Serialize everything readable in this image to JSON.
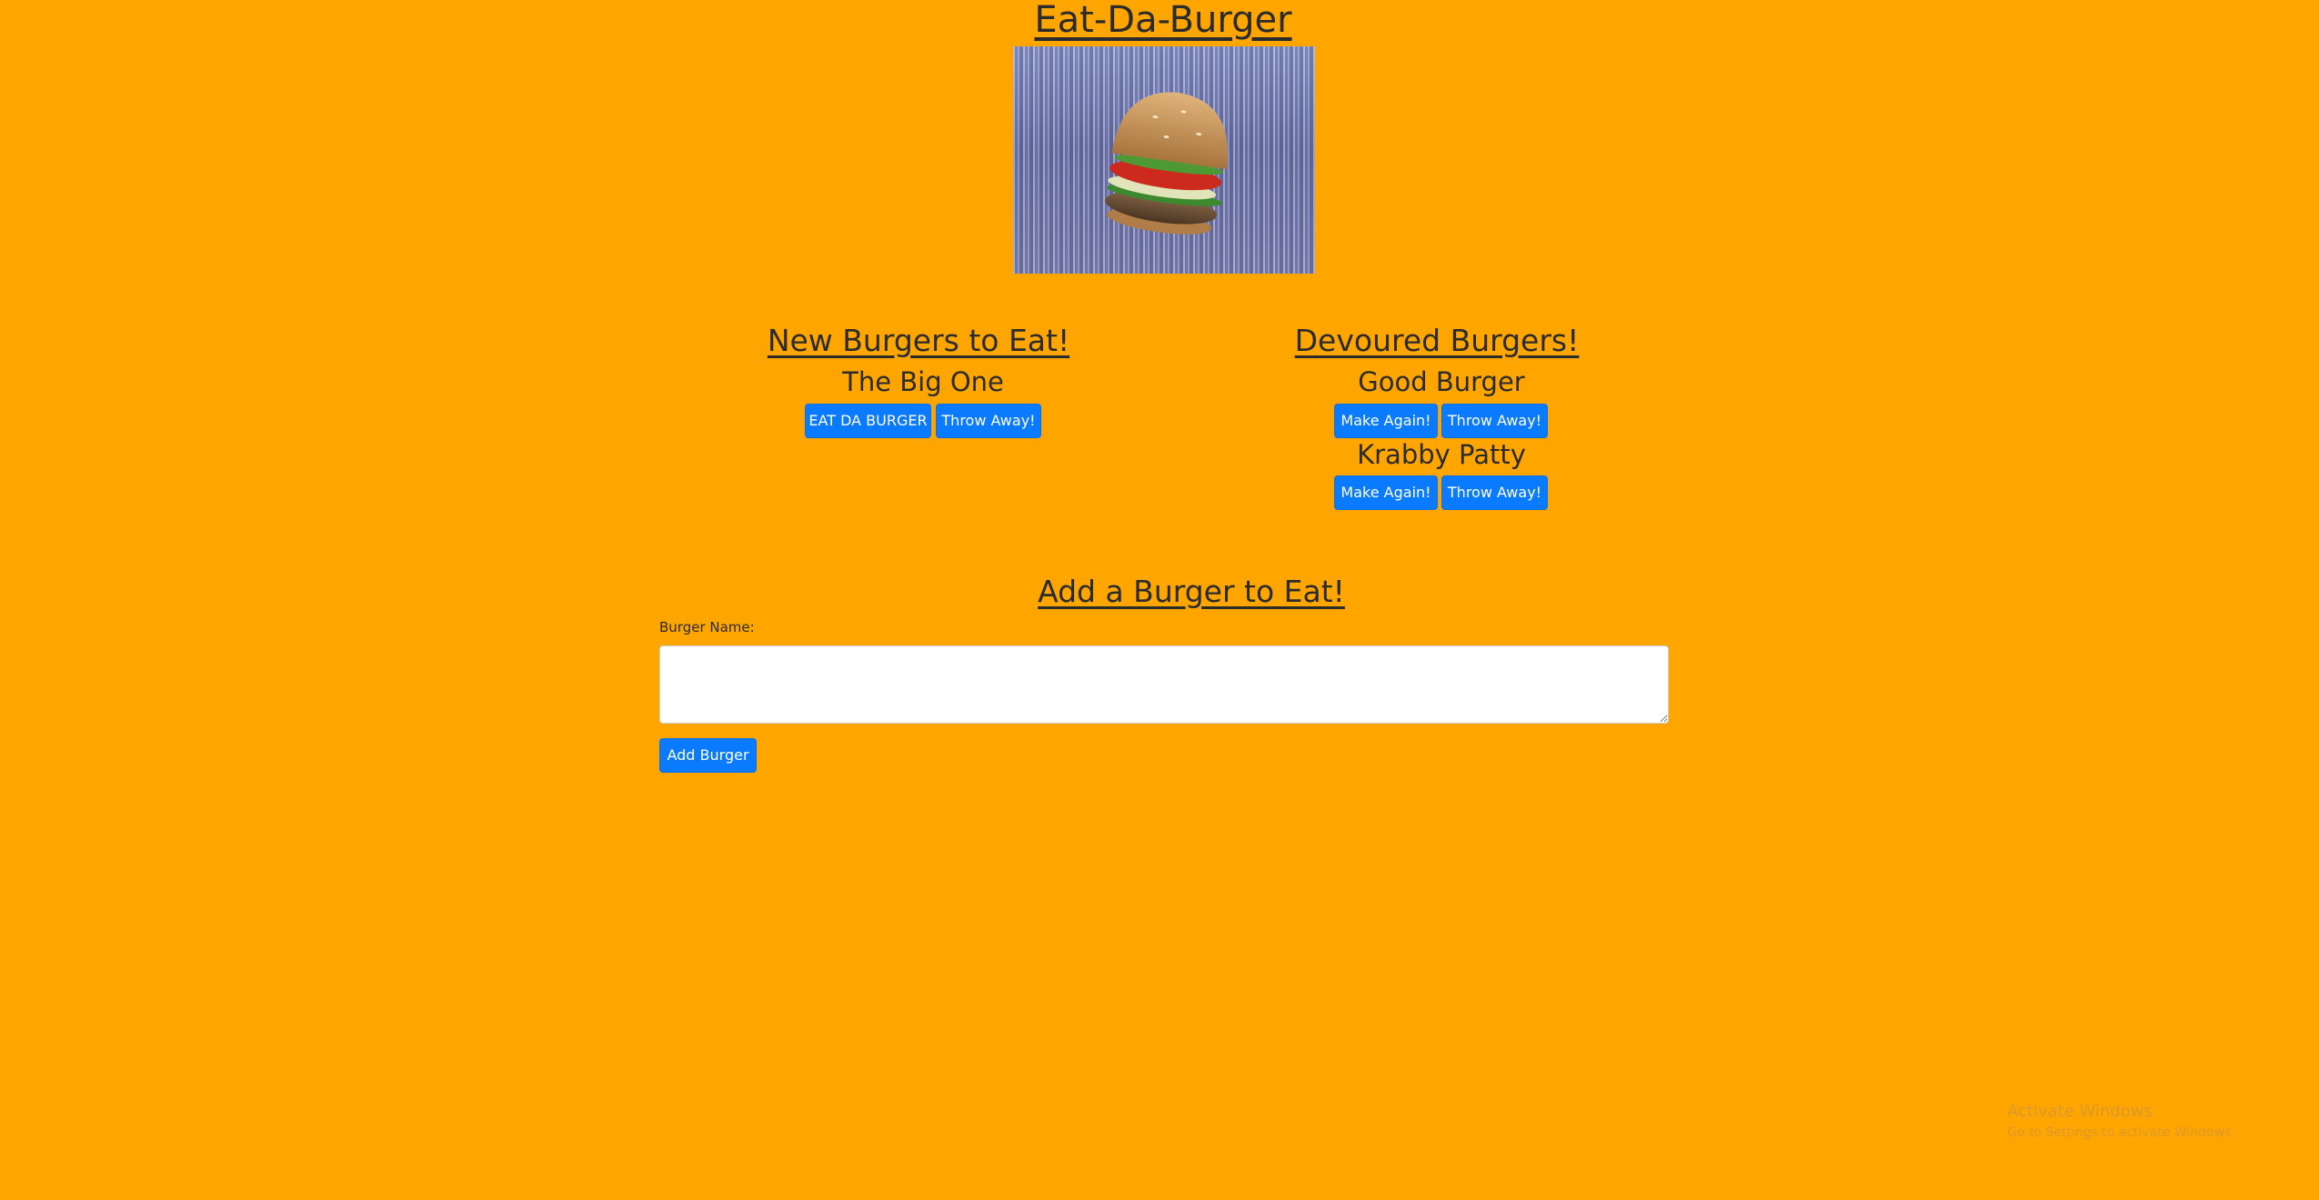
{
  "page": {
    "title": "Eat-Da-Burger",
    "background_color": "#FFA500",
    "button_color": "#0a7bff"
  },
  "hero_image": {
    "icon": "burger-image"
  },
  "new_burgers": {
    "heading": "New Burgers to Eat!",
    "items": [
      {
        "name": "The Big One",
        "eat_label": "EAT DA BURGER",
        "throw_label": "Throw Away!"
      }
    ]
  },
  "devoured_burgers": {
    "heading": "Devoured Burgers!",
    "items": [
      {
        "name": "Good Burger",
        "make_label": "Make Again!",
        "throw_label": "Throw Away!"
      },
      {
        "name": "Krabby Patty",
        "make_label": "Make Again!",
        "throw_label": "Throw Away!"
      }
    ]
  },
  "add_form": {
    "heading": "Add a Burger to Eat!",
    "field_label": "Burger Name:",
    "field_value": "",
    "submit_label": "Add Burger"
  },
  "os_watermark": {
    "line1": "Activate Windows",
    "line2": "Go to Settings to activate Windows."
  }
}
